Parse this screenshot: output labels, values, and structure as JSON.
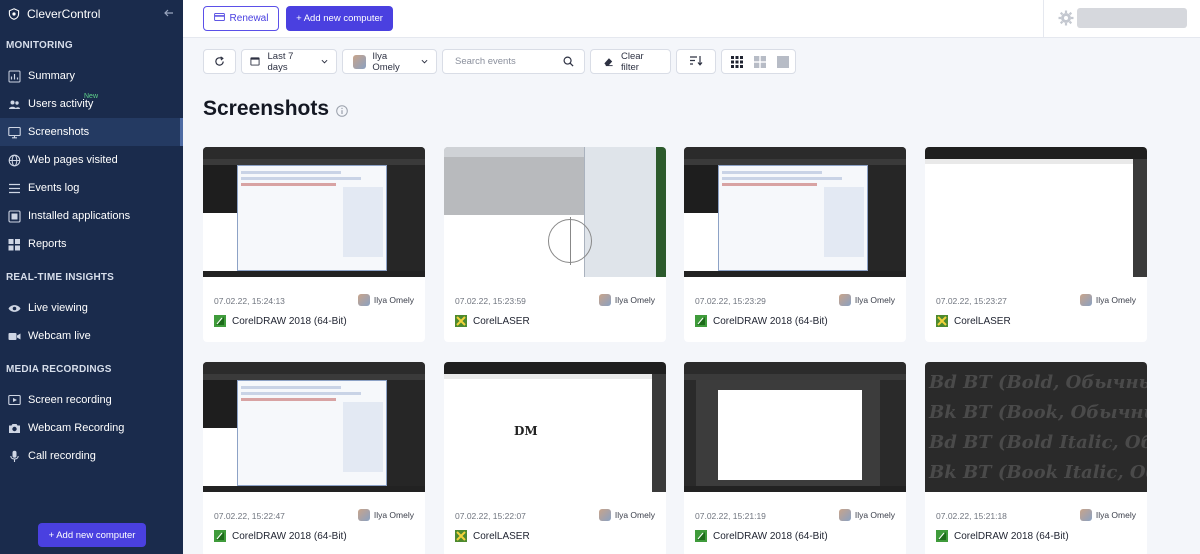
{
  "brand": {
    "name": "CleverControl"
  },
  "sidebar": {
    "sections": [
      {
        "title": "MONITORING",
        "items": [
          {
            "label": "Summary",
            "icon": "chart-icon"
          },
          {
            "label": "Users activity",
            "icon": "users-icon",
            "badge": "New"
          },
          {
            "label": "Screenshots",
            "icon": "monitor-icon",
            "active": true
          },
          {
            "label": "Web pages visited",
            "icon": "globe-icon"
          },
          {
            "label": "Events log",
            "icon": "list-icon"
          },
          {
            "label": "Installed applications",
            "icon": "apps-icon"
          },
          {
            "label": "Reports",
            "icon": "grid-icon"
          }
        ]
      },
      {
        "title": "REAL-TIME INSIGHTS",
        "items": [
          {
            "label": "Live viewing",
            "icon": "eye-icon"
          },
          {
            "label": "Webcam live",
            "icon": "camera-icon"
          }
        ]
      },
      {
        "title": "MEDIA RECORDINGS",
        "items": [
          {
            "label": "Screen recording",
            "icon": "play-icon"
          },
          {
            "label": "Webcam Recording",
            "icon": "photo-camera-icon"
          },
          {
            "label": "Call recording",
            "icon": "mic-icon"
          }
        ]
      }
    ],
    "add_button": "+ Add new computer"
  },
  "topbar": {
    "renewal_label": "Renewal",
    "add_label": "+ Add new computer"
  },
  "filters": {
    "date_range": "Last 7 days",
    "user": "Ilya Omely",
    "search_placeholder": "Search events",
    "clear_label": "Clear filter"
  },
  "page": {
    "title": "Screenshots"
  },
  "screenshots": [
    {
      "date": "07.02.22, 15:24:13",
      "user": "Ilya Omely",
      "app": "CorelDRAW 2018 (64-Bit)",
      "app_kind": "draw"
    },
    {
      "date": "07.02.22, 15:23:59",
      "user": "Ilya Omely",
      "app": "CorelLASER",
      "app_kind": "laser"
    },
    {
      "date": "07.02.22, 15:23:29",
      "user": "Ilya Omely",
      "app": "CorelDRAW 2018 (64-Bit)",
      "app_kind": "draw"
    },
    {
      "date": "07.02.22, 15:23:27",
      "user": "Ilya Omely",
      "app": "CorelLASER",
      "app_kind": "laser"
    },
    {
      "date": "07.02.22, 15:22:47",
      "user": "Ilya Omely",
      "app": "CorelDRAW 2018 (64-Bit)",
      "app_kind": "draw"
    },
    {
      "date": "07.02.22, 15:22:07",
      "user": "Ilya Omely",
      "app": "CorelLASER",
      "app_kind": "laser",
      "thumb_text": "DM"
    },
    {
      "date": "07.02.22, 15:21:19",
      "user": "Ilya Omely",
      "app": "CorelDRAW 2018 (64-Bit)",
      "app_kind": "draw"
    },
    {
      "date": "07.02.22, 15:21:18",
      "user": "Ilya Omely",
      "app": "CorelDRAW 2018 (64-Bit)",
      "app_kind": "draw",
      "thumb_lines": [
        "Bd BT (Bold, Обычный)",
        "Bk BT (Book, Обычный)",
        "Bd BT (Bold Italic, Обычный к",
        "Bk BT (Book Italic, Обычный курс"
      ]
    }
  ],
  "colors": {
    "sidebar": "#1a2b4c",
    "accent": "#4a40e0",
    "background": "#f4f6fa"
  }
}
